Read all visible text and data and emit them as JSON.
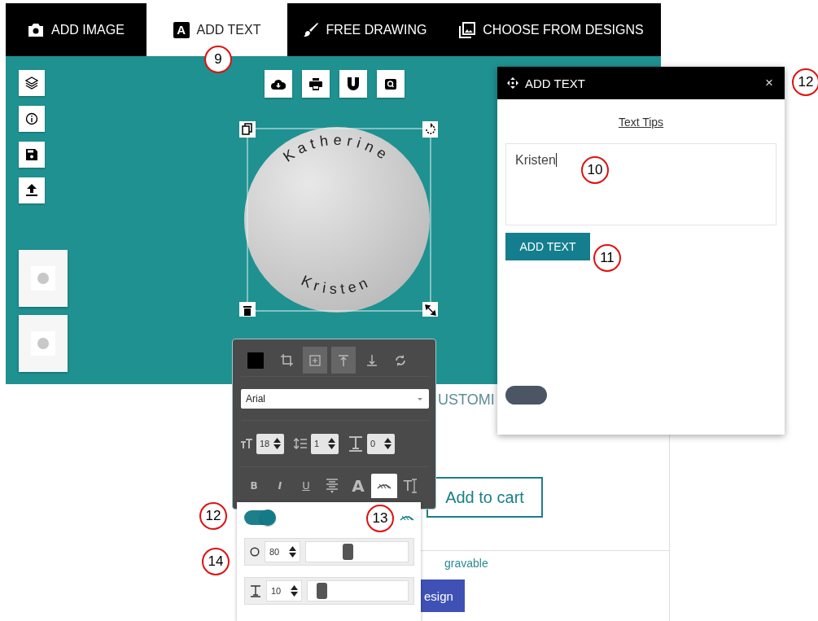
{
  "tabs": [
    {
      "label": "ADD IMAGE",
      "kind": "camera",
      "selected": false
    },
    {
      "label": "ADD TEXT",
      "kind": "letter",
      "icon_label": "A",
      "selected": true
    },
    {
      "label": "FREE DRAWING",
      "kind": "brush",
      "selected": false
    },
    {
      "label": "CHOOSE FROM DESIGNS",
      "kind": "images",
      "selected": false
    }
  ],
  "canvas": {
    "side_tools": [
      {
        "kind": "layers"
      },
      {
        "kind": "info"
      },
      {
        "kind": "save"
      },
      {
        "kind": "upload"
      }
    ],
    "thumbnails": [
      {
        "kind": "locket"
      },
      {
        "kind": "locket"
      }
    ],
    "top_tools": [
      {
        "kind": "cloud-download"
      },
      {
        "kind": "print"
      },
      {
        "kind": "magnet"
      },
      {
        "kind": "zoom"
      }
    ],
    "design": {
      "top_text": "Katherine",
      "bottom_text": "Kristen"
    }
  },
  "text_toolbar": {
    "color": "#000000",
    "tools": [
      {
        "kind": "crop",
        "selected": false
      },
      {
        "kind": "center",
        "selected": true
      },
      {
        "kind": "align-top",
        "selected": true
      },
      {
        "kind": "align-bottom",
        "selected": false
      },
      {
        "kind": "rotate",
        "selected": false
      }
    ],
    "font": "Arial",
    "spinners": [
      {
        "kind": "font-size",
        "value": "18"
      },
      {
        "kind": "line-height",
        "value": "1"
      },
      {
        "kind": "letter-spacing",
        "value": "0"
      }
    ],
    "format_buttons": [
      {
        "kind": "bold",
        "label": "B",
        "selected": false
      },
      {
        "kind": "italic",
        "label": "I",
        "selected": false
      },
      {
        "kind": "underline",
        "label": "U",
        "selected": false
      },
      {
        "kind": "align",
        "selected": false
      },
      {
        "kind": "outline",
        "label": "A",
        "selected": false
      },
      {
        "kind": "curve",
        "selected": true
      },
      {
        "kind": "text-cursor",
        "label": "T",
        "selected": false
      }
    ]
  },
  "curve_panel": {
    "on": true,
    "sliders": [
      {
        "kind": "radius",
        "value": "80",
        "level": 0.41
      },
      {
        "kind": "spacing",
        "value": "10",
        "level": 0.14
      }
    ]
  },
  "dialog": {
    "title": "ADD TEXT",
    "close": "×",
    "link": "Text Tips",
    "text_value": "Kristen",
    "button": "ADD TEXT"
  },
  "product": {
    "title": "USTOMI",
    "cart_button": "Add to cart",
    "engravable": "gravable",
    "design_button": "esign"
  },
  "annotations": [
    {
      "label": "9"
    },
    {
      "label": "10"
    },
    {
      "label": "11"
    },
    {
      "label": "12"
    },
    {
      "label": "12"
    },
    {
      "label": "13"
    },
    {
      "label": "14"
    }
  ]
}
